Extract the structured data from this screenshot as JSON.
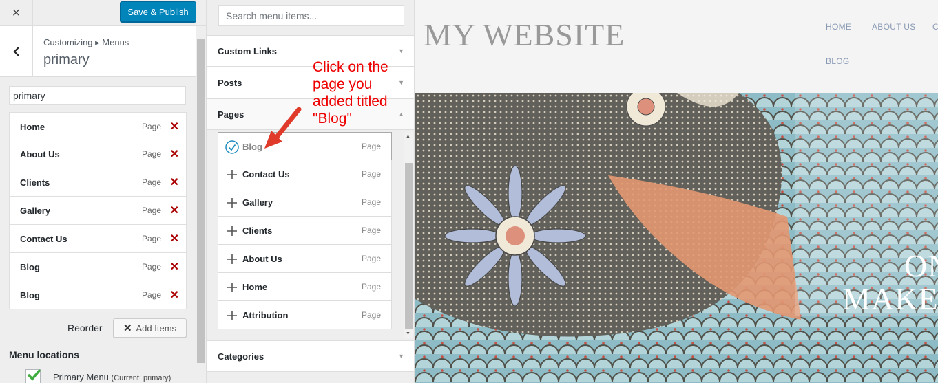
{
  "topbar": {
    "close_label": "×",
    "publish_label": "Save & Publish"
  },
  "section": {
    "breadcrumb": "Customizing ▸ Menus",
    "title": "primary"
  },
  "menu": {
    "name_value": "primary",
    "items": [
      {
        "title": "Home",
        "type": "Page"
      },
      {
        "title": "About Us",
        "type": "Page"
      },
      {
        "title": "Clients",
        "type": "Page"
      },
      {
        "title": "Gallery",
        "type": "Page"
      },
      {
        "title": "Contact Us",
        "type": "Page"
      },
      {
        "title": "Blog",
        "type": "Page"
      },
      {
        "title": "Blog",
        "type": "Page"
      }
    ],
    "reorder_label": "Reorder",
    "add_items_label": "Add Items",
    "locations_title": "Menu locations",
    "location_label": "Primary Menu",
    "location_current": "(Current: primary)"
  },
  "available": {
    "search_placeholder": "Search menu items...",
    "sections": {
      "custom_links": "Custom Links",
      "posts": "Posts",
      "pages": "Pages",
      "categories": "Categories"
    },
    "pages": [
      {
        "title": "Blog",
        "type": "Page",
        "added": true
      },
      {
        "title": "Contact Us",
        "type": "Page",
        "added": false
      },
      {
        "title": "Gallery",
        "type": "Page",
        "added": false
      },
      {
        "title": "Clients",
        "type": "Page",
        "added": false
      },
      {
        "title": "About Us",
        "type": "Page",
        "added": false
      },
      {
        "title": "Home",
        "type": "Page",
        "added": false
      },
      {
        "title": "Attribution",
        "type": "Page",
        "added": false
      }
    ]
  },
  "annotation": {
    "text": "Click on the page you added titled \"Blog\"",
    "color": "#e00000"
  },
  "preview": {
    "site_title": "MY WEBSITE",
    "nav": [
      "HOME",
      "ABOUT US",
      "C",
      "BLOG"
    ],
    "hero_text_line1": "ON",
    "hero_text_line2": "MAKE"
  },
  "colors": {
    "primary_button": "#0085ba",
    "delete": "#aa0000",
    "check": "#1e8cbe"
  }
}
